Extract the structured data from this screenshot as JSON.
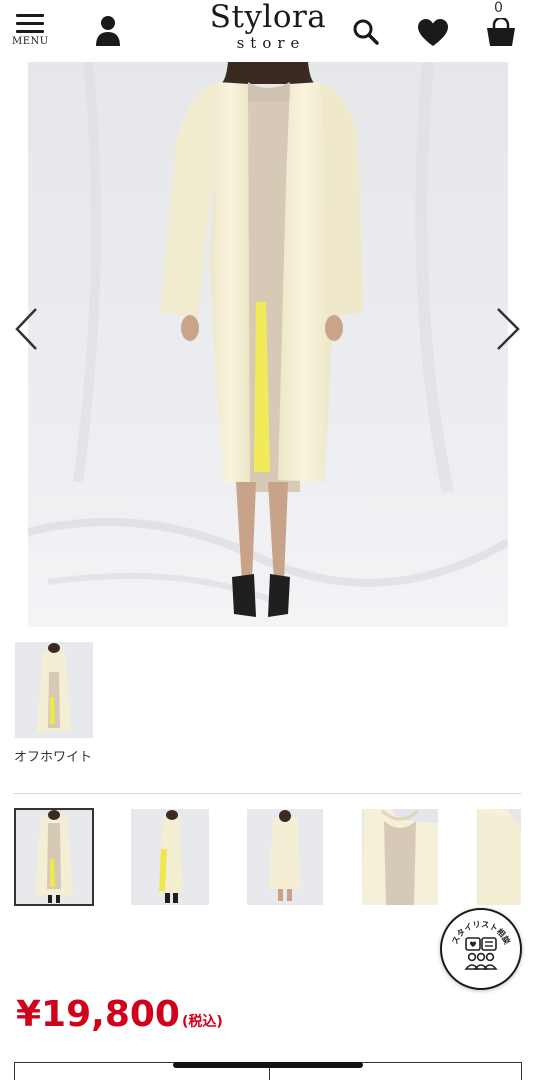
{
  "header": {
    "menu_label": "MENU",
    "logo_main": "Stylora",
    "logo_sub": "store",
    "cart_count": "0"
  },
  "product": {
    "color_name": "オフホワイト",
    "price": "¥19,800",
    "tax_note": "(税込)"
  },
  "gallery": {
    "image_count": 5,
    "active_index": 0
  },
  "stylist_badge": {
    "label": "スタイリスト相談"
  },
  "colors": {
    "price_red": "#d0021b",
    "coat": "#f6f1d8",
    "yellow_lining": "#f3ea5a",
    "backdrop": "#e9eaee"
  }
}
